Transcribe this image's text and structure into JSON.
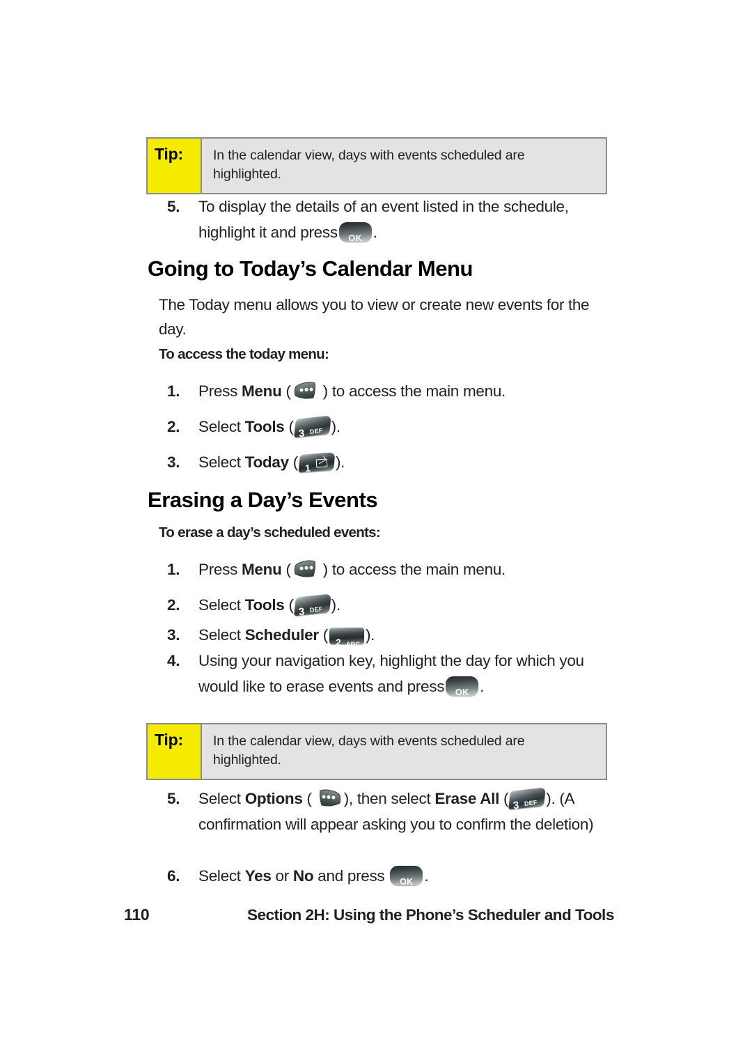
{
  "document": {
    "page_number": "110",
    "footer_section": "Section 2H: Using the Phone’s Scheduler and Tools"
  },
  "tip_top": {
    "label": "Tip:",
    "text": "In the calendar view, days with events scheduled are highlighted."
  },
  "step_5_top": {
    "number": "5.",
    "text_before": "To display the details of an event listed in the schedule, highlight it and press",
    "text_after": "."
  },
  "section_today": {
    "heading": "Going to Today’s Calendar Menu",
    "intro": "The Today menu allows you to view or create new events for the day.",
    "subheading": "To access the today menu:",
    "steps": [
      {
        "number": "1.",
        "before": "Press",
        "bold": "Menu",
        "paren_open": "(",
        "paren_close": ")",
        "after": "to access the main menu."
      },
      {
        "number": "2.",
        "before": "Select",
        "bold": "Tools",
        "paren_open": "(",
        "paren_close": ").",
        "after": ""
      },
      {
        "number": "3.",
        "before": "Select",
        "bold": "Today",
        "paren_open": "(",
        "paren_close": ").",
        "after": ""
      }
    ]
  },
  "section_erase": {
    "heading": "Erasing a Day’s Events",
    "subheading": "To erase a day’s scheduled events:",
    "steps": [
      {
        "number": "1.",
        "before": "Press",
        "bold": "Menu",
        "paren_open": "(",
        "paren_close": ")",
        "after": "to access the main menu."
      },
      {
        "number": "2.",
        "before": "Select",
        "bold": "Tools",
        "paren_open": "(",
        "paren_close": ").",
        "after": ""
      },
      {
        "number": "3.",
        "before": "Select",
        "bold": "Scheduler",
        "paren_open": "(",
        "paren_close": ").",
        "after": ""
      },
      {
        "number": "4.",
        "before": "Using your navigation key, highlight the day for which you would like to erase events and press",
        "bold": "",
        "paren_open": "",
        "paren_close": ".",
        "after": ""
      }
    ]
  },
  "tip_bottom": {
    "label": "Tip:",
    "text": "In the calendar view, days with events scheduled are highlighted."
  },
  "step_5_bottom": {
    "number": "5.",
    "before": "Select",
    "bold1": "Options",
    "mid": "), then select",
    "bold2": "Erase All",
    "after": "). (A confirmation will appear asking you to confirm the deletion)"
  },
  "step_6_bottom": {
    "number": "6.",
    "before": "Select",
    "bold1": "Yes",
    "mid": "or",
    "bold2": "No",
    "after": "and press",
    "end": "."
  },
  "keys": {
    "ok": "OK",
    "three_digit": "3",
    "three_sub": "DEF",
    "two_digit": "2",
    "two_sub": "ABC",
    "one_digit": "1",
    "soft_menu": "menu-softkey",
    "soft_options": "options-softkey"
  },
  "colors": {
    "tip_label_bg": "#f5eb00",
    "tip_body_bg": "#e3e3e3",
    "tip_border": "#8c8c8c",
    "text": "#231f20",
    "key_dark": "#232b2e",
    "key_light": "#cfd5d6"
  }
}
